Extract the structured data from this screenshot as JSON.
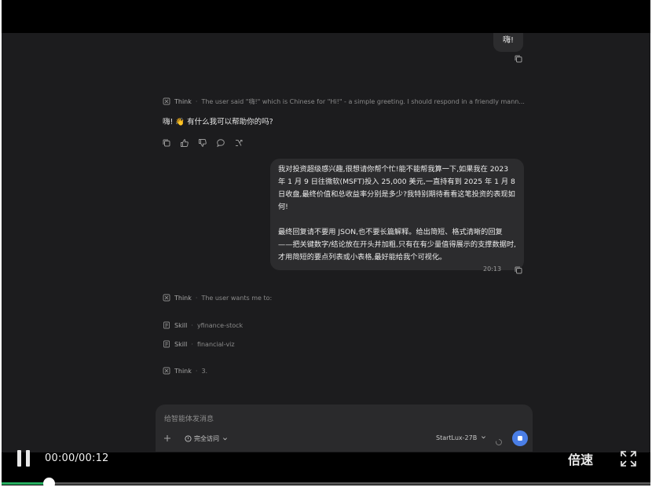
{
  "chat": {
    "user_greeting": "嗨!",
    "think1": {
      "label": "Think",
      "sep": "·",
      "text": "The user said \"嗨!\" which is Chinese for \"Hi!\" - a simple greeting. I should respond in a friendly mann..."
    },
    "assistant_reply": "嗨! 👋 有什么我可以帮助你的吗?",
    "user_question": {
      "para1": "我对投资超级感兴趣,很想请你帮个忙!能不能帮我算一下,如果我在 2023 年 1 月 9 日往微软(MSFT)投入 25,000 美元,一直持有到 2025 年 1 月 8 日收盘,最终价值和总收益率分别是多少?我特别期待看看这笔投资的表现如何!",
      "para2": "最终回复请不要用 JSON,也不要长篇解释。给出简短、格式清晰的回复——把关键数字/结论放在开头并加粗,只有在有少量值得展示的支撑数据时,才用简短的要点列表或小表格,最好能给我个可视化。"
    },
    "timestamp": "20:13",
    "think2": {
      "label": "Think",
      "sep": "·",
      "text": "The user wants me to:"
    },
    "skill1": {
      "label": "Skill",
      "sep": "·",
      "text": "yfinance-stock"
    },
    "skill2": {
      "label": "Skill",
      "sep": "·",
      "text": "financial-viz"
    },
    "think3": {
      "label": "Think",
      "sep": "·",
      "text": "3."
    }
  },
  "composer": {
    "placeholder": "给智能体发消息",
    "access_label": "完全访问",
    "model_label": "StartLux-27B"
  },
  "player": {
    "time": "00:00/00:12",
    "speed_label": "倍速",
    "progress_fraction": 0.0
  },
  "colors": {
    "send_button": "#4a7ee6",
    "progress": "#27ae60",
    "screen_bg": "#1c1c1e"
  }
}
